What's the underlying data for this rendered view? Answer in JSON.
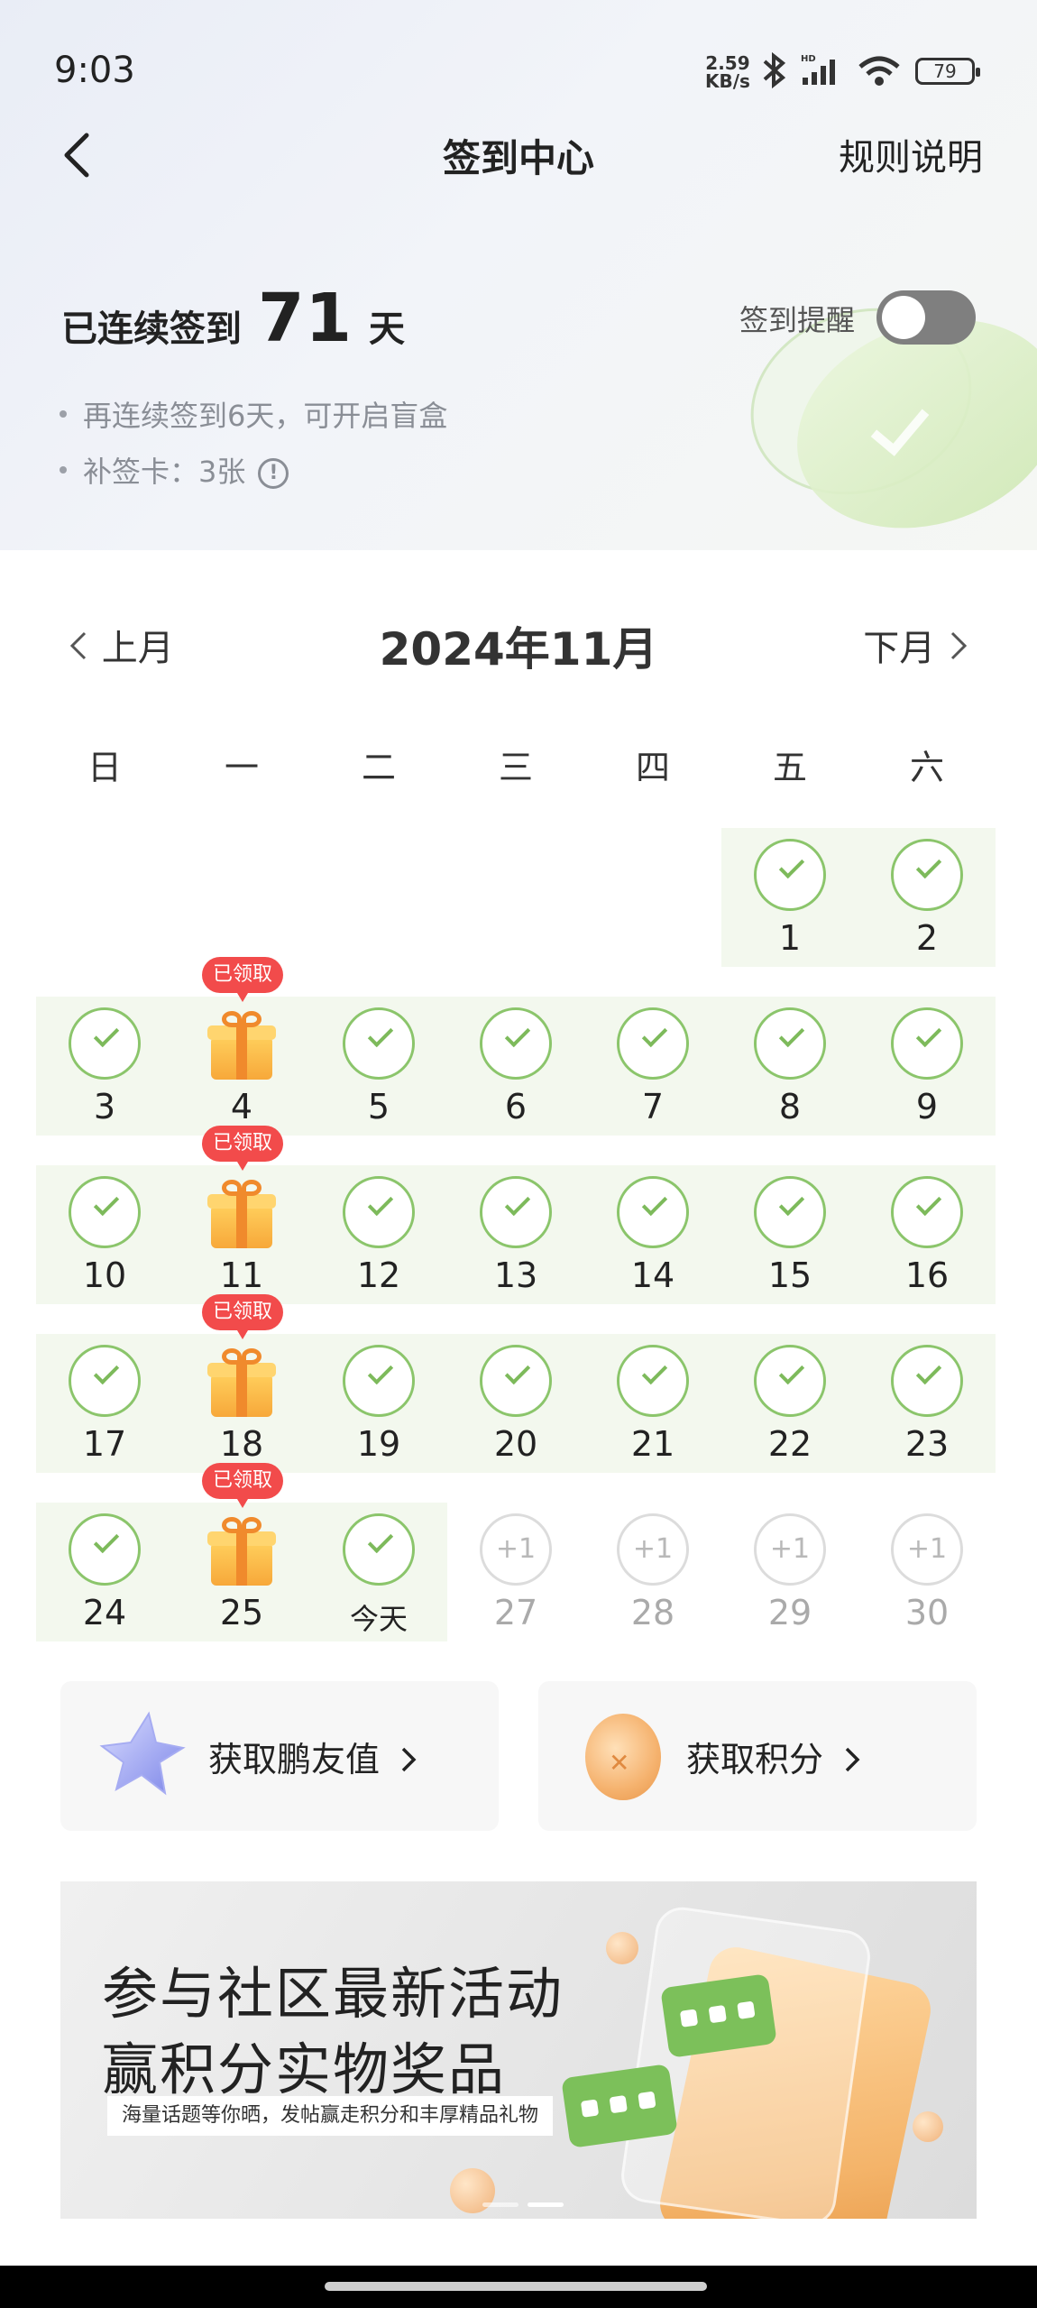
{
  "status_bar": {
    "time": "9:03",
    "net_speed_value": "2.59",
    "net_speed_unit": "KB/s",
    "battery": "79"
  },
  "nav": {
    "title": "签到中心",
    "rules": "规则说明"
  },
  "summary": {
    "streak_prefix": "已连续签到",
    "streak_days": "71",
    "streak_suffix": "天",
    "reminder_label": "签到提醒",
    "reminder_on": false,
    "tip1": "再连续签到6天，可开启盲盒",
    "tip2": "补签卡：3张"
  },
  "calendar": {
    "prev_label": "上月",
    "next_label": "下月",
    "month_title": "2024年11月",
    "weekdays": [
      "日",
      "一",
      "二",
      "三",
      "四",
      "五",
      "六"
    ],
    "gift_badge": "已领取",
    "plus_label": "+1",
    "today_label": "今天",
    "days": {
      "d1": "1",
      "d2": "2",
      "d3": "3",
      "d4": "4",
      "d5": "5",
      "d6": "6",
      "d7": "7",
      "d8": "8",
      "d9": "9",
      "d10": "10",
      "d11": "11",
      "d12": "12",
      "d13": "13",
      "d14": "14",
      "d15": "15",
      "d16": "16",
      "d17": "17",
      "d18": "18",
      "d19": "19",
      "d20": "20",
      "d21": "21",
      "d22": "22",
      "d23": "23",
      "d24": "24",
      "d25": "25",
      "d27": "27",
      "d28": "28",
      "d29": "29",
      "d30": "30"
    }
  },
  "actions": {
    "friend_value": "获取鹏友值",
    "points": "获取积分"
  },
  "banner": {
    "line1": "参与社区最新活动",
    "line2": "赢积分实物奖品",
    "subtitle": "海量话题等你晒，发帖赢走积分和丰厚精品礼物"
  }
}
